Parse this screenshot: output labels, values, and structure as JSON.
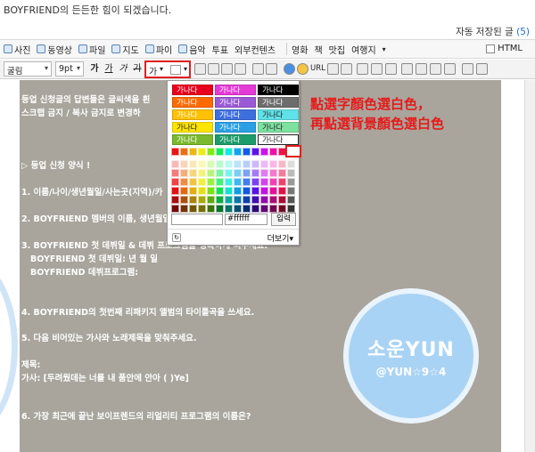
{
  "intro_text": "BOYFRIEND의 든든한 힘이 되겠습니다.",
  "autosave": {
    "label": "자동 저장된 글",
    "count": "(5)"
  },
  "toolbar1": {
    "items": [
      "사진",
      "동영상",
      "파일",
      "지도",
      "파이",
      "음악",
      "투표",
      "외부컨텐츠",
      "영화",
      "책",
      "맛집",
      "여행지"
    ],
    "html_label": "HTML"
  },
  "toolbar2": {
    "font": "굴림",
    "size": "9pt",
    "bold": "가",
    "underline": "가",
    "italic": "가",
    "strike": "가",
    "text_color": "가",
    "url_label": "URL"
  },
  "palette_popup": {
    "samples": [
      {
        "text": "가나다",
        "bg": "#e8001c",
        "fg": "#ffffff"
      },
      {
        "text": "가나다",
        "bg": "#e53ad6",
        "fg": "#ffffff"
      },
      {
        "text": "가나다",
        "bg": "#000000",
        "fg": "#ffffff"
      },
      {
        "text": "가나다",
        "bg": "#ff6a00",
        "fg": "#ffffff"
      },
      {
        "text": "가나다",
        "bg": "#9b59d6",
        "fg": "#ffffff"
      },
      {
        "text": "가나다",
        "bg": "#6d6d6d",
        "fg": "#ffffff"
      },
      {
        "text": "가나다",
        "bg": "#ffc000",
        "fg": "#ffffff"
      },
      {
        "text": "가나다",
        "bg": "#3e6fe0",
        "fg": "#ffffff"
      },
      {
        "text": "가나다",
        "bg": "#5fe2e8",
        "fg": "#222222"
      },
      {
        "text": "가나다",
        "bg": "#ffe400",
        "fg": "#222222"
      },
      {
        "text": "가나다",
        "bg": "#2b9fe6",
        "fg": "#ffffff"
      },
      {
        "text": "가나다",
        "bg": "#7de2a0",
        "fg": "#222222"
      },
      {
        "text": "가나다",
        "bg": "#7ab82d",
        "fg": "#ffffff"
      },
      {
        "text": "가나다",
        "bg": "#1c9b6b",
        "fg": "#ffffff"
      },
      {
        "text": "가나다",
        "bg": "#ffffff",
        "fg": "#222222"
      }
    ],
    "hex_value": "#ffffff",
    "apply_label": "입력",
    "more_label": "더보기"
  },
  "editor": {
    "background": "#a9a59c",
    "lines": [
      "등업 신청글의 답변들은 글씨색을 흰",
      "스크랩 금지 / 복사 금지로 변경하",
      "▷ 등업 신청 양식 !",
      "1. 이름/나이/생년월일/사는곳(지역)/카",
      "2. BOYFRIEND 멤버의 이름, 생년월일",
      "3. BOYFRIEND 첫 데뷔일 & 데뷔 프로그램을 정확하게 써주세요.",
      "BOYFRIEND 첫 데뷔일: 년 월 일",
      "BOYFRIEND 데뷔프로그램:",
      "4. BOYFRIEND의 첫번째 리패키지 앨범의 타이틀곡을 쓰세요.",
      "5. 다음 비어있는 가사와 노래제목을 맞춰주세요.",
      "제목:",
      "가사: [두려웠데는 너를 내 품안에 안아 ( )Ye]",
      "6. 가장 최근에 끝난 보이프렌드의 리얼리티 프로그램의 이름은?"
    ]
  },
  "watermark": {
    "main": "소운YUN",
    "handle": "@YUN☆9☆4"
  },
  "annotation": [
    "點選字顏色選白色，",
    "再點選背景顏色選白色"
  ],
  "colors": {
    "accent_red": "#e51b1b",
    "link_blue": "#1a6ed8"
  }
}
